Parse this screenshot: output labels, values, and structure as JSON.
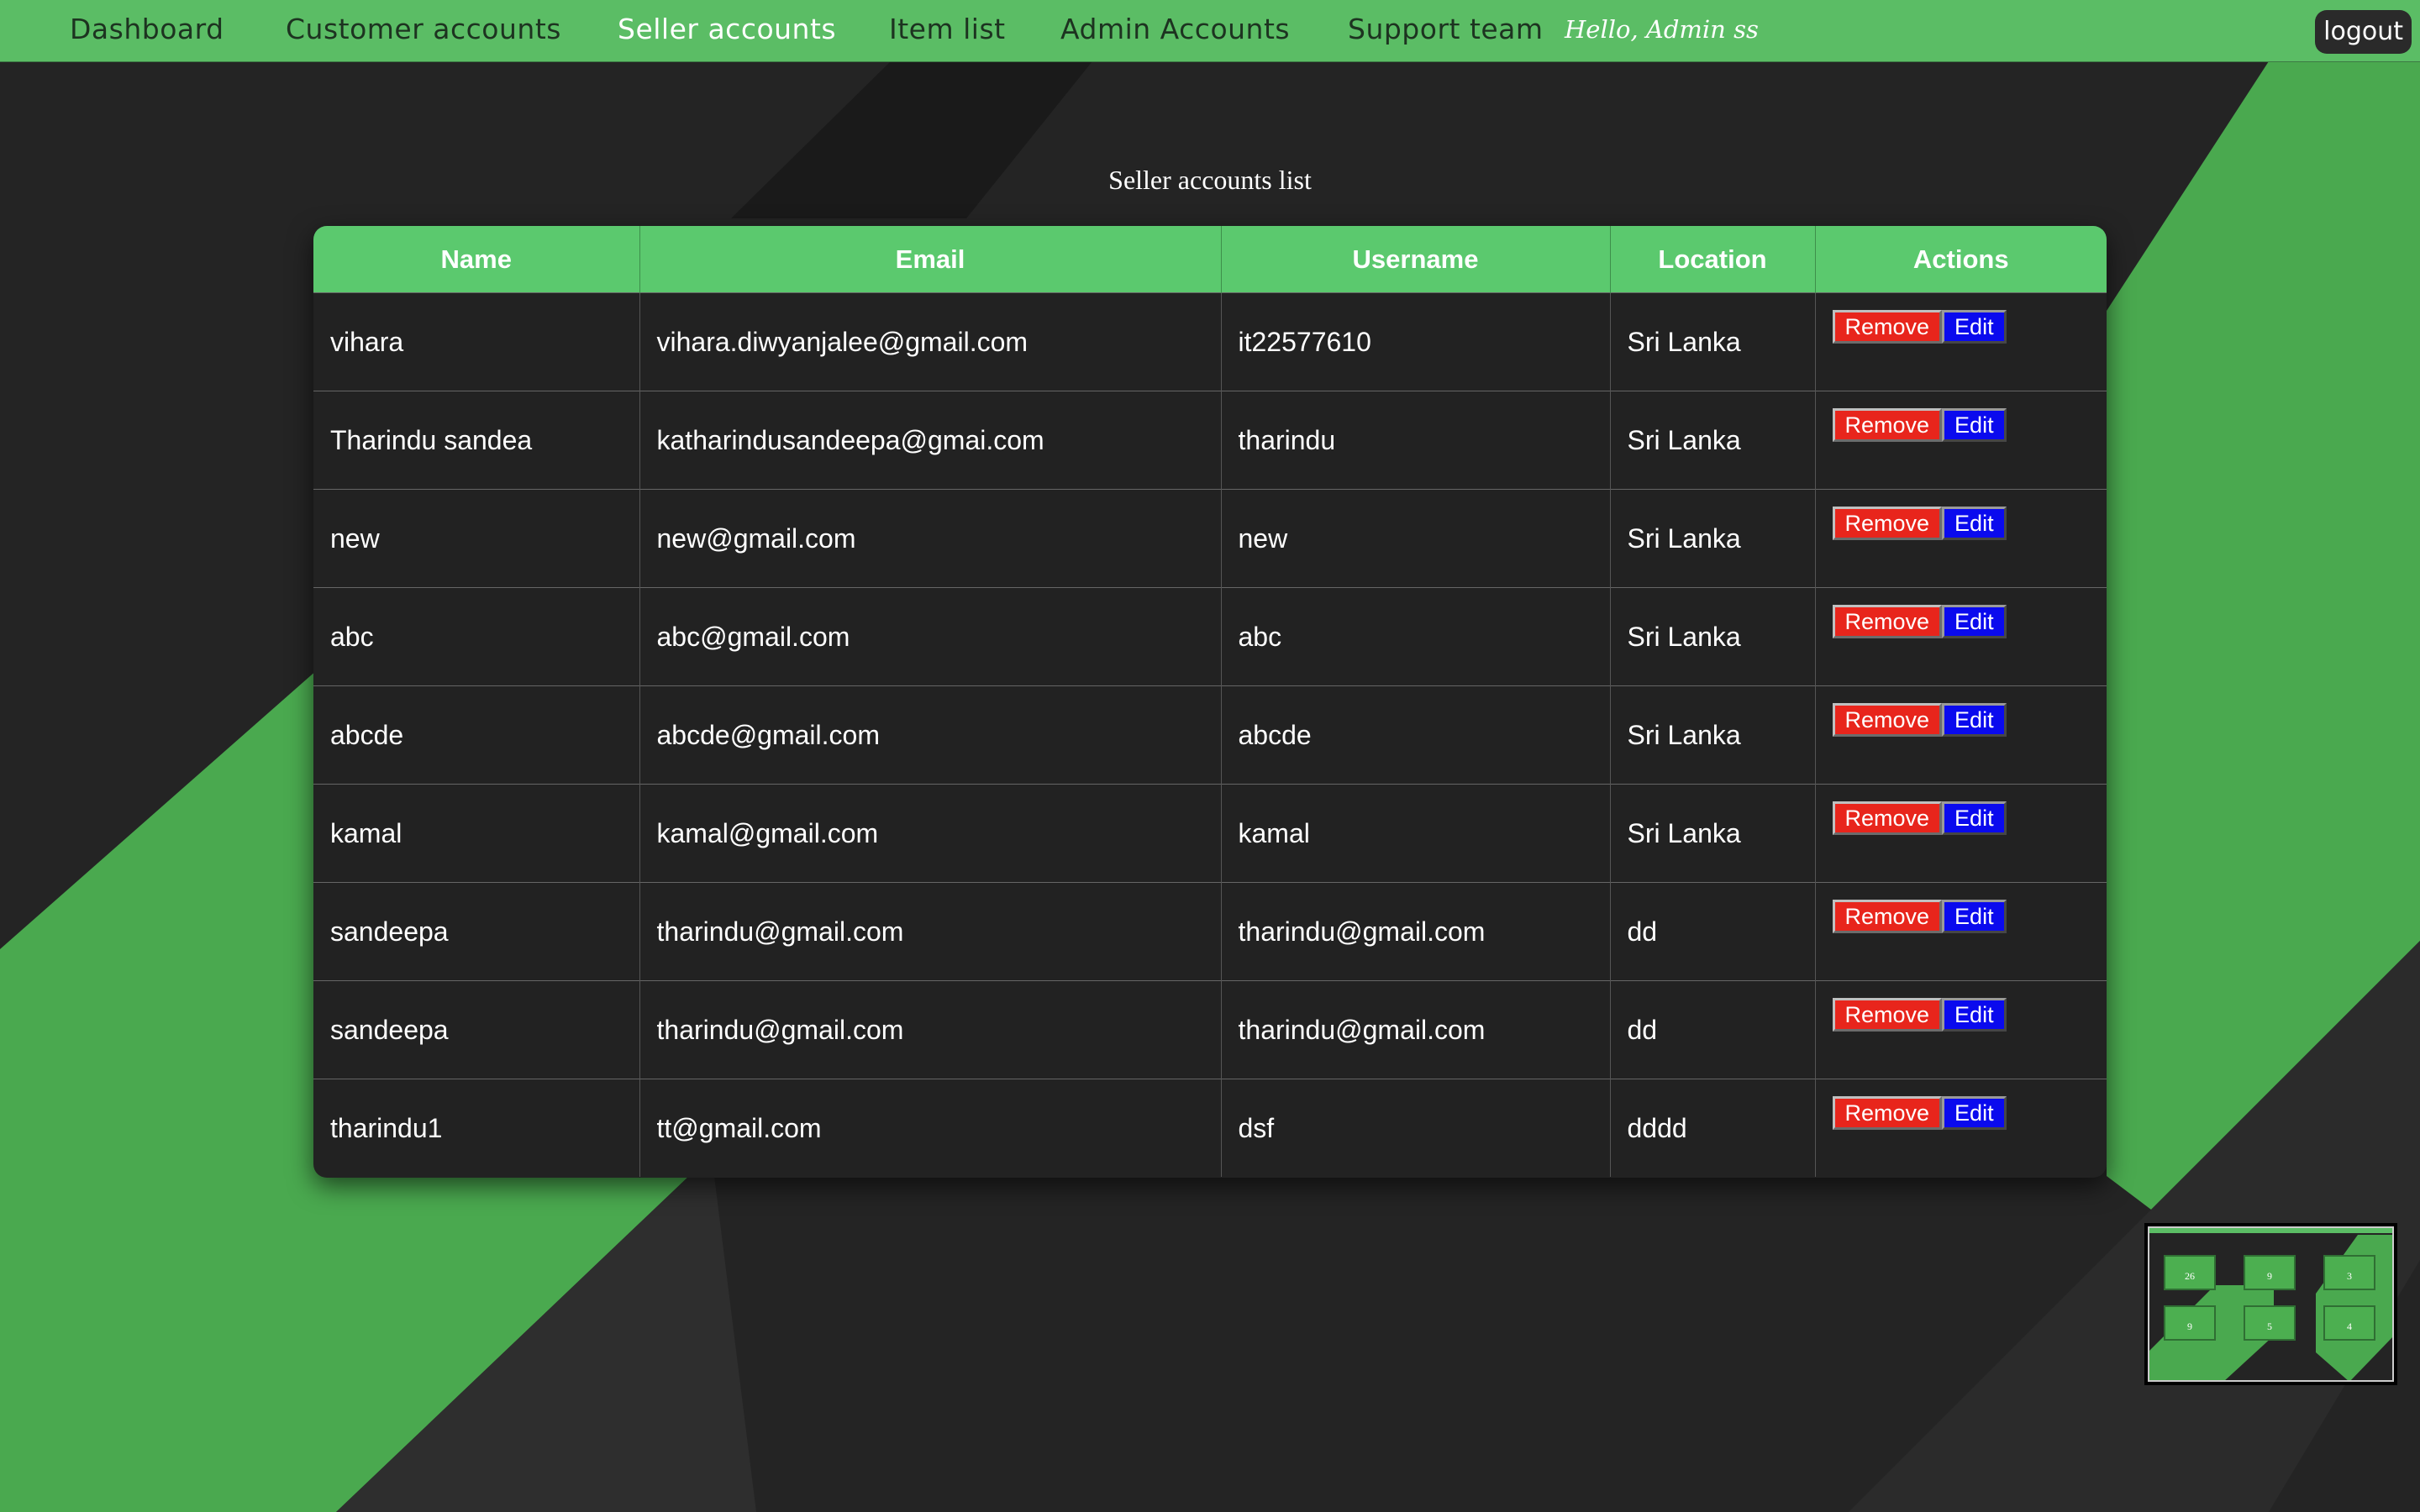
{
  "nav": {
    "items": [
      {
        "label": "Dashboard",
        "active": false
      },
      {
        "label": "Customer accounts",
        "active": false
      },
      {
        "label": "Seller accounts",
        "active": true
      },
      {
        "label": "Item list",
        "active": false
      },
      {
        "label": "Admin Accounts",
        "active": false
      },
      {
        "label": "Support team",
        "active": false
      }
    ],
    "greeting": "Hello, Admin ss",
    "logout_label": "logout"
  },
  "page": {
    "title": "Seller accounts list"
  },
  "table": {
    "headers": [
      "Name",
      "Email",
      "Username",
      "Location",
      "Actions"
    ],
    "remove_label": "Remove",
    "edit_label": "Edit",
    "rows": [
      {
        "name": "vihara",
        "email": "vihara.diwyanjalee@gmail.com",
        "username": "it22577610",
        "location": "Sri Lanka"
      },
      {
        "name": "Tharindu sandea",
        "email": "katharindusandeepa@gmai.com",
        "username": "tharindu",
        "location": "Sri Lanka"
      },
      {
        "name": "new",
        "email": "new@gmail.com",
        "username": "new",
        "location": "Sri Lanka"
      },
      {
        "name": "abc",
        "email": "abc@gmail.com",
        "username": "abc",
        "location": "Sri Lanka"
      },
      {
        "name": "abcde",
        "email": "abcde@gmail.com",
        "username": "abcde",
        "location": "Sri Lanka"
      },
      {
        "name": "kamal",
        "email": "kamal@gmail.com",
        "username": "kamal",
        "location": "Sri Lanka"
      },
      {
        "name": "sandeepa",
        "email": "tharindu@gmail.com",
        "username": "tharindu@gmail.com",
        "location": "dd"
      },
      {
        "name": "sandeepa",
        "email": "tharindu@gmail.com",
        "username": "tharindu@gmail.com",
        "location": "dd"
      },
      {
        "name": "tharindu1",
        "email": "tt@gmail.com",
        "username": "dsf",
        "location": "dddd"
      }
    ]
  },
  "preview": {
    "cards": [
      "26",
      "9",
      "3",
      "9",
      "5",
      "4"
    ]
  },
  "colors": {
    "nav_bg": "#5bbd65",
    "header_bg": "#5bc96e",
    "band_green": "#4caf50",
    "background_dark": "#232323",
    "remove_red": "#e8251c",
    "edit_blue": "#0a0aee"
  }
}
